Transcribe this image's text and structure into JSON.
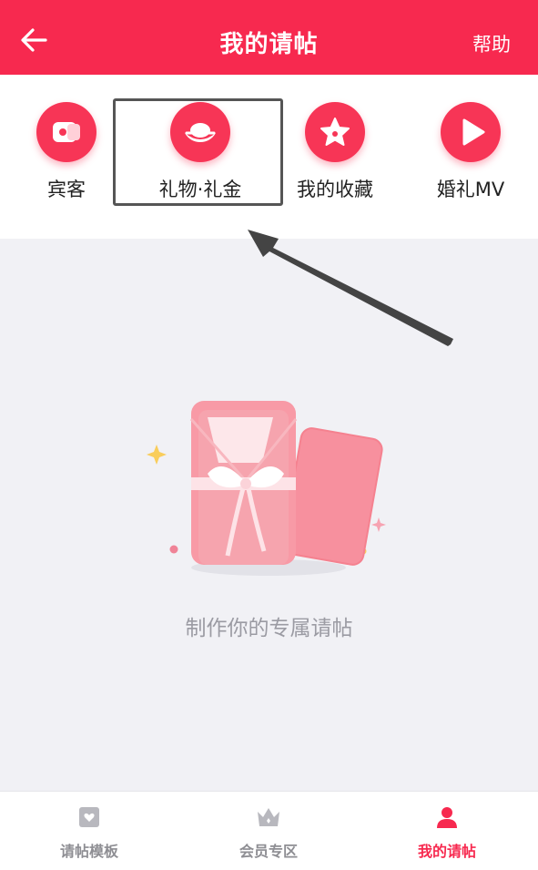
{
  "header": {
    "title": "我的请帖",
    "help_label": "帮助"
  },
  "shortcuts": [
    {
      "label": "宾客",
      "icon": "guests-icon"
    },
    {
      "label": "礼物·礼金",
      "icon": "gift-money-icon"
    },
    {
      "label": "我的收藏",
      "icon": "star-icon"
    },
    {
      "label": "婚礼MV",
      "icon": "play-icon"
    }
  ],
  "empty_state": {
    "text": "制作你的专属请帖",
    "icon": "invitation-gift-illustration"
  },
  "tabbar": {
    "items": [
      {
        "label": "请帖模板",
        "icon": "template-icon",
        "active": false
      },
      {
        "label": "会员专区",
        "icon": "crown-icon",
        "active": false
      },
      {
        "label": "我的请帖",
        "icon": "user-icon",
        "active": true
      }
    ]
  },
  "colors": {
    "brand": "#f7294f",
    "background": "#f1f1f5",
    "muted_text": "#9b9ba3"
  }
}
